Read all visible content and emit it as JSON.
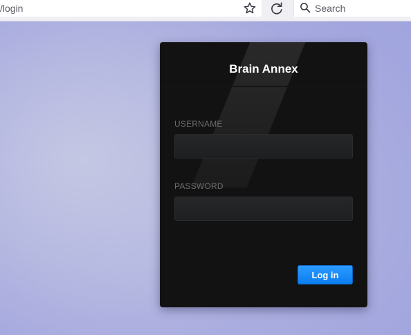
{
  "browser": {
    "url_text": "/login",
    "search_placeholder": "Search",
    "icons": {
      "bookmark": "star-icon",
      "reload": "reload-icon",
      "search": "search-icon"
    }
  },
  "login_card": {
    "title": "Brain Annex",
    "username_label": "USERNAME",
    "username_value": "",
    "password_label": "PASSWORD",
    "password_value": "",
    "submit_label": "Log in"
  },
  "colors": {
    "card_background": "#121212",
    "accent_button": "#1a8cff",
    "page_background": "#a9add9"
  }
}
